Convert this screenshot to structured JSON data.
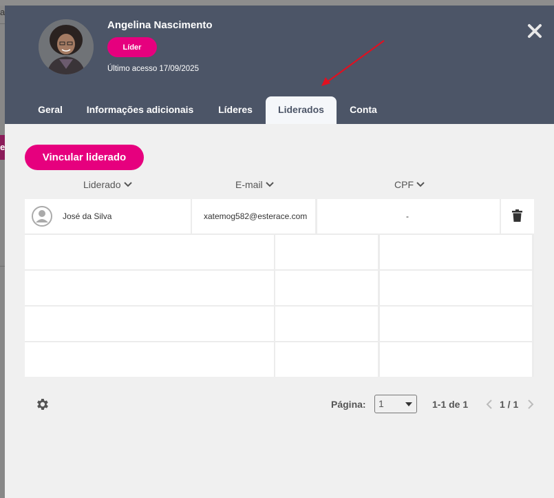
{
  "backdrop": {
    "char_top": "a",
    "char_pink": "e"
  },
  "profile": {
    "name": "Angelina Nascimento",
    "role_badge": "Líder",
    "last_access": "Último acesso 17/09/2025"
  },
  "tabs": [
    {
      "label": "Geral"
    },
    {
      "label": "Informações adicionais"
    },
    {
      "label": "Líderes"
    },
    {
      "label": "Liderados",
      "active": true
    },
    {
      "label": "Conta"
    }
  ],
  "actions": {
    "link_button": "Vincular liderado"
  },
  "table": {
    "columns": [
      {
        "label": "Liderado"
      },
      {
        "label": "E-mail"
      },
      {
        "label": "CPF"
      }
    ],
    "rows": [
      {
        "name": "José da Silva",
        "email": "xatemog582@esterace.com",
        "cpf": "-"
      }
    ]
  },
  "pagination": {
    "page_label": "Página:",
    "page_value": "1",
    "range": "1-1 de 1",
    "pages": "1 / 1"
  },
  "colors": {
    "header_bg": "#4c5567",
    "accent": "#e6007e",
    "body_bg": "#f0f0f0"
  },
  "icons": [
    "close-icon",
    "chevron-down-icon",
    "user-icon",
    "trash-icon",
    "gear-icon",
    "chevron-left-icon",
    "chevron-right-icon"
  ]
}
